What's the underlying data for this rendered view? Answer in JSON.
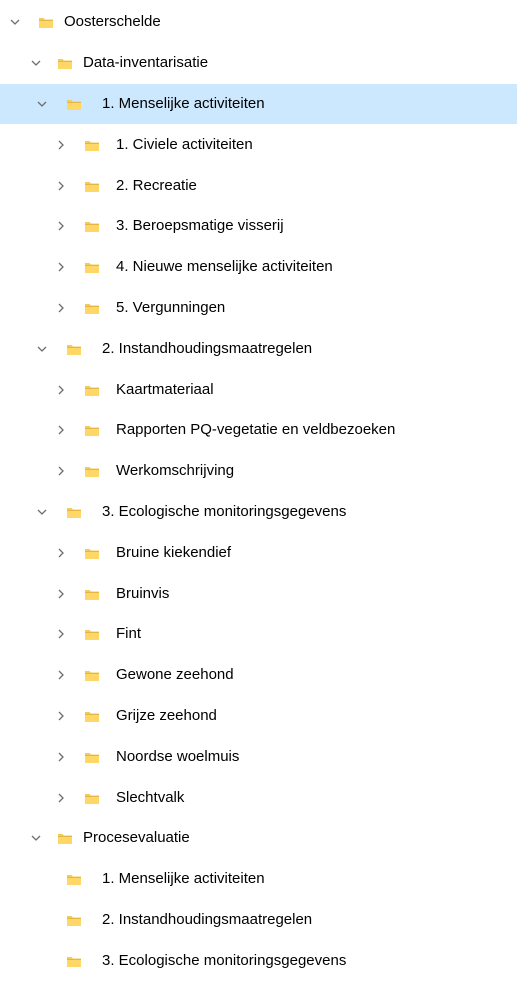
{
  "colors": {
    "selection": "#cce8ff",
    "chevron": "#6e6e6e",
    "folder": "#f2cc5b"
  },
  "tree": [
    {
      "label": "Oosterschelde",
      "state": "expanded",
      "icon": "folder-icon"
    },
    {
      "label": "Data-inventarisatie",
      "state": "expanded",
      "icon": "folder-icon"
    },
    {
      "label": "1. Menselijke activiteiten",
      "state": "expanded",
      "icon": "folder-icon",
      "selected": true
    },
    {
      "label": "1. Civiele activiteiten",
      "state": "collapsed",
      "icon": "folder-icon"
    },
    {
      "label": "2. Recreatie",
      "state": "collapsed",
      "icon": "folder-icon"
    },
    {
      "label": "3. Beroepsmatige visserij",
      "state": "collapsed",
      "icon": "folder-icon"
    },
    {
      "label": "4. Nieuwe menselijke activiteiten",
      "state": "collapsed",
      "icon": "folder-icon"
    },
    {
      "label": "5. Vergunningen",
      "state": "collapsed",
      "icon": "folder-icon"
    },
    {
      "label": "2. Instandhoudingsmaatregelen",
      "state": "expanded",
      "icon": "folder-icon"
    },
    {
      "label": "Kaartmateriaal",
      "state": "collapsed",
      "icon": "folder-icon"
    },
    {
      "label": "Rapporten PQ-vegetatie en veldbezoeken",
      "state": "collapsed",
      "icon": "folder-icon"
    },
    {
      "label": "Werkomschrijving",
      "state": "collapsed",
      "icon": "folder-icon"
    },
    {
      "label": "3. Ecologische monitoringsgegevens",
      "state": "expanded",
      "icon": "folder-icon"
    },
    {
      "label": "Bruine kiekendief",
      "state": "collapsed",
      "icon": "folder-icon"
    },
    {
      "label": "Bruinvis",
      "state": "collapsed",
      "icon": "folder-icon"
    },
    {
      "label": "Fint",
      "state": "collapsed",
      "icon": "folder-icon"
    },
    {
      "label": "Gewone zeehond",
      "state": "collapsed",
      "icon": "folder-icon"
    },
    {
      "label": "Grijze zeehond",
      "state": "collapsed",
      "icon": "folder-icon"
    },
    {
      "label": "Noordse woelmuis",
      "state": "collapsed",
      "icon": "folder-icon"
    },
    {
      "label": "Slechtvalk",
      "state": "collapsed",
      "icon": "folder-icon"
    },
    {
      "label": "Procesevaluatie",
      "state": "expanded",
      "icon": "folder-icon"
    },
    {
      "label": "1. Menselijke activiteiten",
      "state": "leaf",
      "icon": "folder-icon"
    },
    {
      "label": "2. Instandhoudingsmaatregelen",
      "state": "leaf",
      "icon": "folder-icon"
    },
    {
      "label": "3. Ecologische monitoringsgegevens",
      "state": "leaf",
      "icon": "folder-icon"
    }
  ]
}
